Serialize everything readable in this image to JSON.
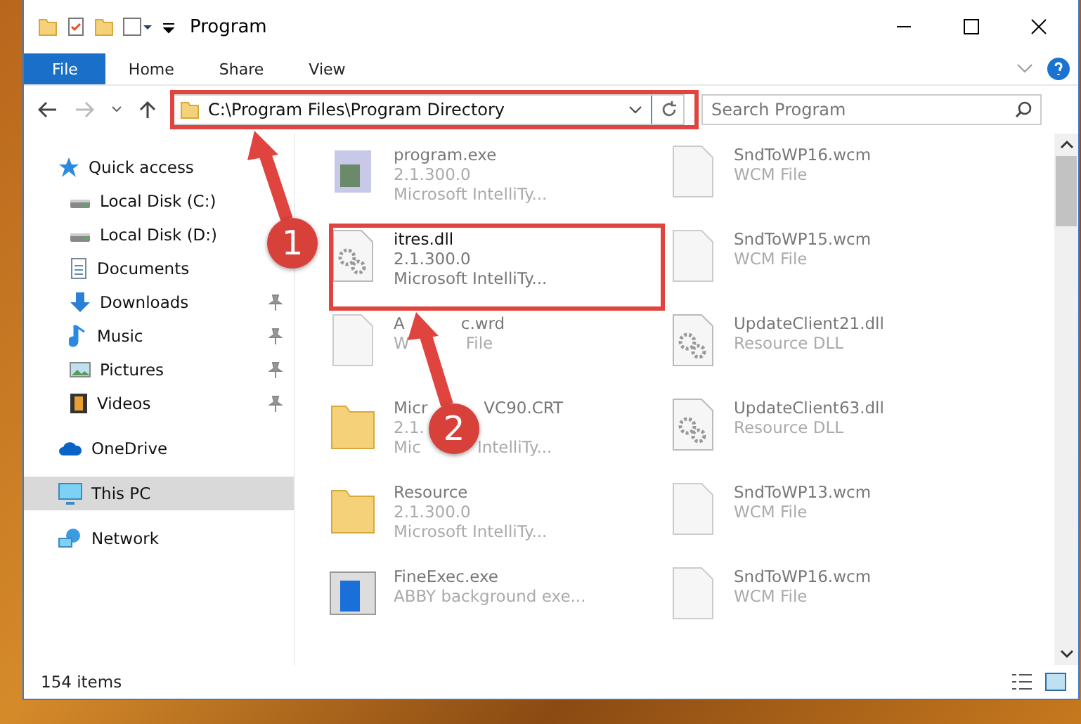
{
  "window": {
    "title": "Program"
  },
  "ribbon_tabs": [
    {
      "label": "File",
      "selected": true
    },
    {
      "label": "Home",
      "selected": false
    },
    {
      "label": "Share",
      "selected": false
    },
    {
      "label": "View",
      "selected": false
    }
  ],
  "address": {
    "path": "C:\\Program Files\\Program Directory"
  },
  "search": {
    "placeholder": "Search Program"
  },
  "nav": [
    {
      "label": "Quick access",
      "kind": "star",
      "selected": false,
      "children": [
        {
          "label": "Local Disk (C:)",
          "kind": "disk",
          "pinned": false,
          "selected": false
        },
        {
          "label": "Local Disk (D:)",
          "kind": "disk",
          "pinned": false,
          "selected": false
        },
        {
          "label": "Documents",
          "kind": "doc",
          "pinned": false,
          "selected": false
        },
        {
          "label": "Downloads",
          "kind": "download",
          "pinned": true,
          "selected": false
        },
        {
          "label": "Music",
          "kind": "music",
          "pinned": true,
          "selected": false
        },
        {
          "label": "Pictures",
          "kind": "picture",
          "pinned": true,
          "selected": false
        },
        {
          "label": "Videos",
          "kind": "video",
          "pinned": true,
          "selected": false
        }
      ]
    },
    {
      "label": "OneDrive",
      "kind": "cloud",
      "selected": false
    },
    {
      "label": "This PC",
      "kind": "pc",
      "selected": true
    },
    {
      "label": "Network",
      "kind": "network",
      "selected": false
    }
  ],
  "files": [
    {
      "name": [
        "program.exe"
      ],
      "lines": [
        [
          "2.1.300.0"
        ],
        [
          "Microsoft IntelliTy..."
        ]
      ],
      "kind": "exe",
      "highlighted": false
    },
    {
      "name": [
        "SndToWP16.wcm"
      ],
      "lines": [
        [
          "WCM File"
        ]
      ],
      "kind": "blank",
      "highlighted": false
    },
    {
      "name": [
        "itres.dll"
      ],
      "lines": [
        [
          "2.1.300.0"
        ],
        [
          "Microsoft IntelliTy..."
        ]
      ],
      "kind": "gear",
      "highlighted": true
    },
    {
      "name": [
        "SndToWP15.wcm"
      ],
      "lines": [
        [
          "WCM File"
        ]
      ],
      "kind": "blank",
      "highlighted": false
    },
    {
      "name": [
        "A",
        "c.wrd"
      ],
      "lines": [
        [
          "W",
          "File"
        ]
      ],
      "kind": "blank",
      "highlighted": false
    },
    {
      "name": [
        "UpdateClient21.dll"
      ],
      "lines": [
        [
          "Resource DLL"
        ]
      ],
      "kind": "gear",
      "highlighted": false
    },
    {
      "name": [
        "Micr",
        "VC90.CRT"
      ],
      "lines": [
        [
          "2.1."
        ],
        [
          "Mic",
          "IntelliTy..."
        ]
      ],
      "kind": "folder",
      "highlighted": false
    },
    {
      "name": [
        "UpdateClient63.dll"
      ],
      "lines": [
        [
          "Resource DLL"
        ]
      ],
      "kind": "gear",
      "highlighted": false
    },
    {
      "name": [
        "Resource"
      ],
      "lines": [
        [
          "2.1.300.0"
        ],
        [
          "Microsoft IntelliTy..."
        ]
      ],
      "kind": "folder",
      "highlighted": false
    },
    {
      "name": [
        "SndToWP13.wcm"
      ],
      "lines": [
        [
          "WCM File"
        ]
      ],
      "kind": "blank",
      "highlighted": false
    },
    {
      "name": [
        "FineExec.exe"
      ],
      "lines": [
        [
          "ABBY background exe..."
        ]
      ],
      "kind": "app",
      "highlighted": false
    },
    {
      "name": [
        "SndToWP16.wcm"
      ],
      "lines": [
        [
          "WCM File"
        ]
      ],
      "kind": "blank",
      "highlighted": false
    }
  ],
  "status_bar": {
    "count": "154 items"
  },
  "annotations": [
    {
      "number": "1"
    },
    {
      "number": "2"
    }
  ]
}
